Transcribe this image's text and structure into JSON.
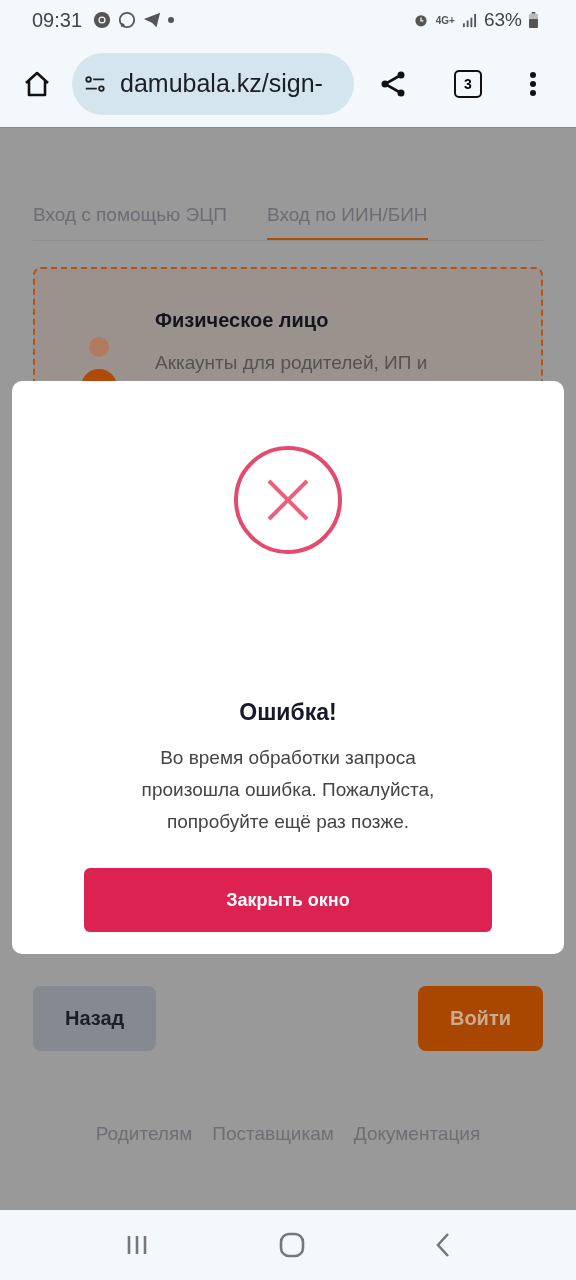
{
  "status_bar": {
    "time": "09:31",
    "network": "4G+",
    "battery": "63%"
  },
  "browser": {
    "url": "damubala.kz/sign-",
    "tab_count": "3"
  },
  "tabs": [
    {
      "label": "Вход с помощью ЭЦП",
      "selected": false
    },
    {
      "label": "Вход по ИИН/БИН",
      "selected": true
    }
  ],
  "account_card": {
    "title": "Физическое лицо",
    "description": "Аккаунты для родителей, ИП и"
  },
  "buttons": {
    "back": "Назад",
    "login": "Войти"
  },
  "footer_links": [
    "Родителям",
    "Поставщикам",
    "Документация"
  ],
  "dialog": {
    "title": "Ошибка!",
    "message": "Во время обработки запроса произошла ошибка. Пожалуйста, попробуйте ещё раз позже.",
    "button": "Закрыть окно"
  }
}
